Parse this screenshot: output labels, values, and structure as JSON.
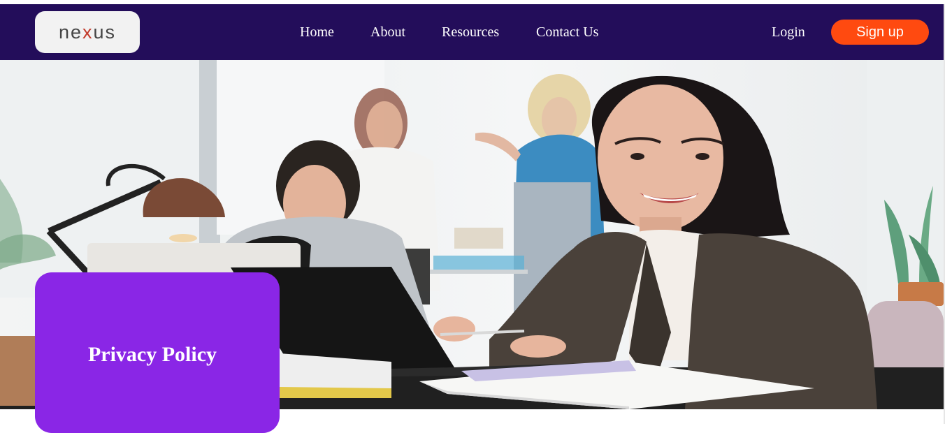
{
  "brand": {
    "logo_text_pre": "ne",
    "logo_text_x": "x",
    "logo_text_post": "us"
  },
  "nav": {
    "items": [
      {
        "label": "Home"
      },
      {
        "label": "About"
      },
      {
        "label": "Resources"
      },
      {
        "label": "Contact Us"
      }
    ],
    "login_label": "Login",
    "signup_label": "Sign up"
  },
  "hero": {
    "image_icon": "office-photo",
    "card_title": "Privacy Policy"
  },
  "colors": {
    "navbar": "#230d5a",
    "signup_button": "#ff4a10",
    "card": "#8a26e6"
  }
}
